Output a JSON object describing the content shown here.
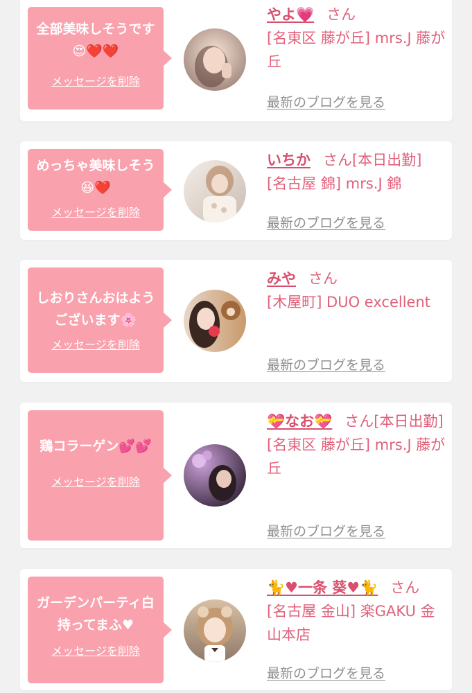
{
  "colors": {
    "page_bg": "#f1f1f1",
    "card_bg": "#ffffff",
    "bubble_bg": "#f9a1ad",
    "name_color": "#d9506e",
    "text_pink": "#e0607a",
    "link_gray": "#8e8e8e"
  },
  "messages": [
    {
      "text": "全部美味しそうです😍❤️❤️",
      "delete_label": "メッセージを削除",
      "name": "やよ💗",
      "honorific": "さん",
      "shop": "[名東区 藤が丘] mrs.J 藤が丘",
      "blog_link": "最新のブログを見る",
      "avatar_icon": "avatar-photo"
    },
    {
      "text": "めっちゃ美味しそう😆❤️",
      "delete_label": "メッセージを削除",
      "name": "いちか",
      "honorific": "さん[本日出勤]",
      "shop": "[名古屋 錦] mrs.J 錦",
      "blog_link": "最新のブログを見る",
      "avatar_icon": "avatar-photo"
    },
    {
      "text": "しおりさんおはようございます🌸",
      "delete_label": "メッセージを削除",
      "name": "みや",
      "honorific": "さん",
      "shop": "[木屋町] DUO excellent",
      "blog_link": "最新のブログを見る",
      "avatar_icon": "avatar-photo"
    },
    {
      "text": "鶏コラーゲン💕💕",
      "delete_label": "メッセージを削除",
      "name": "💝なお💝",
      "honorific": "さん[本日出勤]",
      "shop": "[名東区 藤が丘] mrs.J 藤が丘",
      "blog_link": "最新のブログを見る",
      "avatar_icon": "avatar-photo"
    },
    {
      "text": "ガーデンパーティ白持ってまふ♥",
      "delete_label": "メッセージを削除",
      "name": "🐈♥一条 葵♥🐈",
      "honorific": "さん",
      "shop": "[名古屋 金山] 楽GAKU 金山本店",
      "blog_link": "最新のブログを見る",
      "avatar_icon": "avatar-photo"
    }
  ]
}
